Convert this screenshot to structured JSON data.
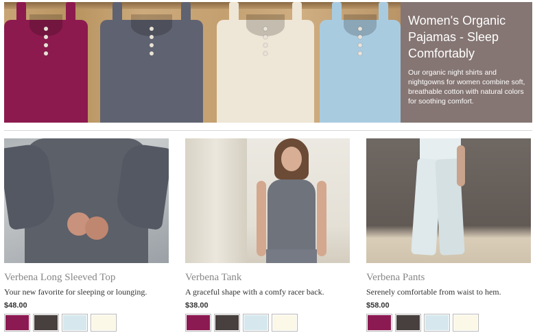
{
  "hero": {
    "title": "Women's Organic Pajamas - Sleep Comfortably",
    "description": "Our organic night shirts and nightgowns for women combine soft, breathable cotton with natural colors for soothing comfort."
  },
  "products": [
    {
      "name": "Verbena Long Sleeved Top",
      "description": "Your new favorite for sleeping or lounging.",
      "price": "$48.00"
    },
    {
      "name": "Verbena Tank",
      "description": "A graceful shape with a comfy racer back.",
      "price": "$38.00"
    },
    {
      "name": "Verbena Pants",
      "description": "Serenely comfortable from waist to hem.",
      "price": "$58.00"
    }
  ],
  "swatch_colors": [
    "#8c1a52",
    "#47403f",
    "#d6e8ee",
    "#fcf8e8"
  ]
}
